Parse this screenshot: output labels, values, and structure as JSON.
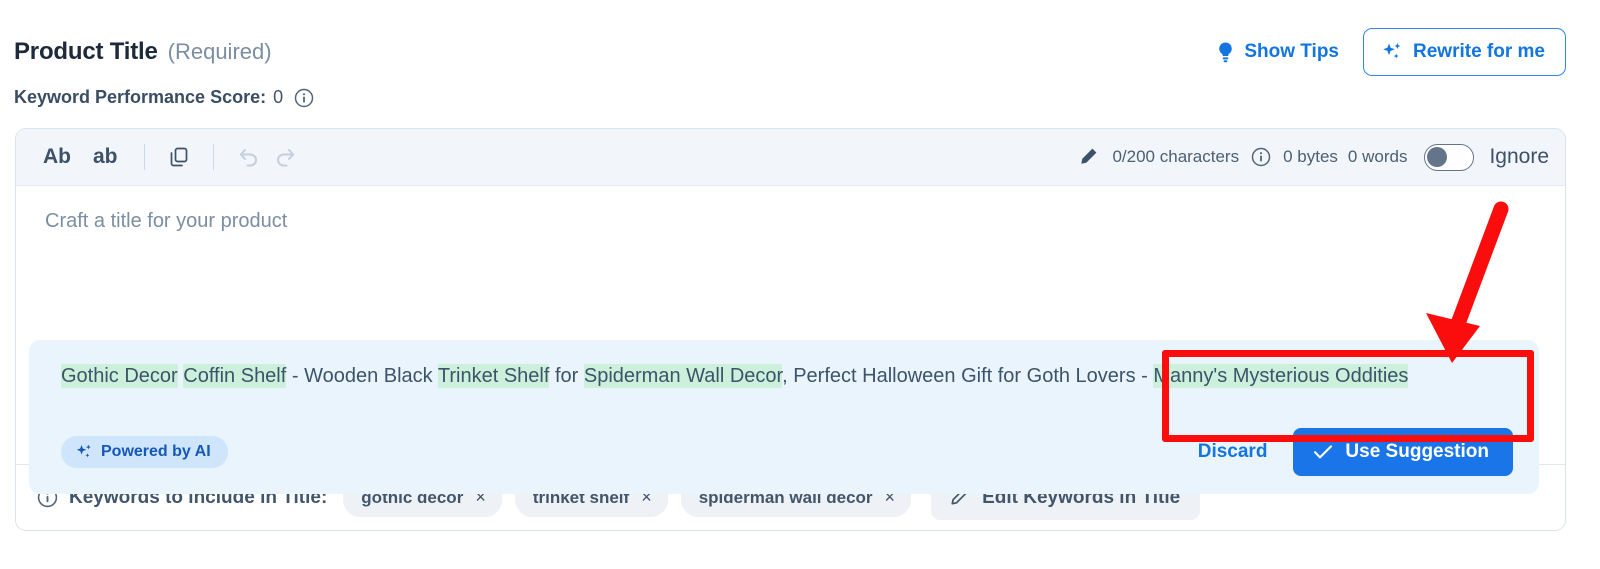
{
  "header": {
    "title": "Product Title",
    "required_note": "(Required)",
    "show_tips_label": "Show Tips",
    "show_tips_icon": "lightbulb-icon",
    "rewrite_label": "Rewrite for me",
    "rewrite_icon": "sparkles-icon"
  },
  "score": {
    "label": "Keyword Performance Score:",
    "value": "0",
    "info_icon": "info-circle-icon"
  },
  "toolbar": {
    "uppercase_label": "Ab",
    "lowercase_label": "ab",
    "copy_icon": "copy-icon",
    "undo_icon": "undo-icon",
    "redo_icon": "redo-icon",
    "pencil_icon": "pencil-icon",
    "characters": "0/200 characters",
    "info_icon": "info-circle-icon",
    "bytes": "0 bytes",
    "words": "0 words",
    "toggle_state": "off",
    "ignore_label": "Ignore"
  },
  "editor": {
    "placeholder": "Craft a title for your product",
    "value": ""
  },
  "suggestion": {
    "segments": [
      {
        "text": "Gothic Decor",
        "highlight": true
      },
      {
        "text": " ",
        "highlight": false
      },
      {
        "text": "Coffin Shelf",
        "highlight": true
      },
      {
        "text": " - Wooden Black ",
        "highlight": false
      },
      {
        "text": "Trinket Shelf",
        "highlight": true
      },
      {
        "text": " for ",
        "highlight": false
      },
      {
        "text": "Spiderman Wall Decor",
        "highlight": true
      },
      {
        "text": ", Perfect Halloween Gift for Goth Lovers - ",
        "highlight": false
      },
      {
        "text": "Manny's Mysterious Oddities",
        "highlight": true
      }
    ],
    "full_text": "Gothic Decor Coffin Shelf - Wooden Black Trinket Shelf for Spiderman Wall Decor, Perfect Halloween Gift for Goth Lovers - Manny's Mysterious Oddities",
    "ai_badge_label": "Powered by AI",
    "ai_badge_icon": "sparkles-icon",
    "discard_label": "Discard",
    "use_suggestion_label": "Use Suggestion",
    "use_suggestion_icon": "check-icon"
  },
  "keywords_footer": {
    "info_icon": "info-circle-icon",
    "label": "Keywords to include in Title:",
    "chips": [
      {
        "text": "gothic decor",
        "remove": "×"
      },
      {
        "text": "trinket shelf",
        "remove": "×"
      },
      {
        "text": "spiderman wall decor",
        "remove": "×"
      }
    ],
    "edit_label": "Edit Keywords in Title",
    "edit_icon": "pencil-icon"
  },
  "annotations": {
    "highlight_color": "#fc0d0d",
    "arrow_color": "#fc0d0d"
  },
  "colors": {
    "accent_blue": "#1a76e8",
    "keyword_highlight": "#ccf0dc",
    "suggestion_bg": "#eaf4fd",
    "toolbar_bg": "#f2f5f9"
  }
}
